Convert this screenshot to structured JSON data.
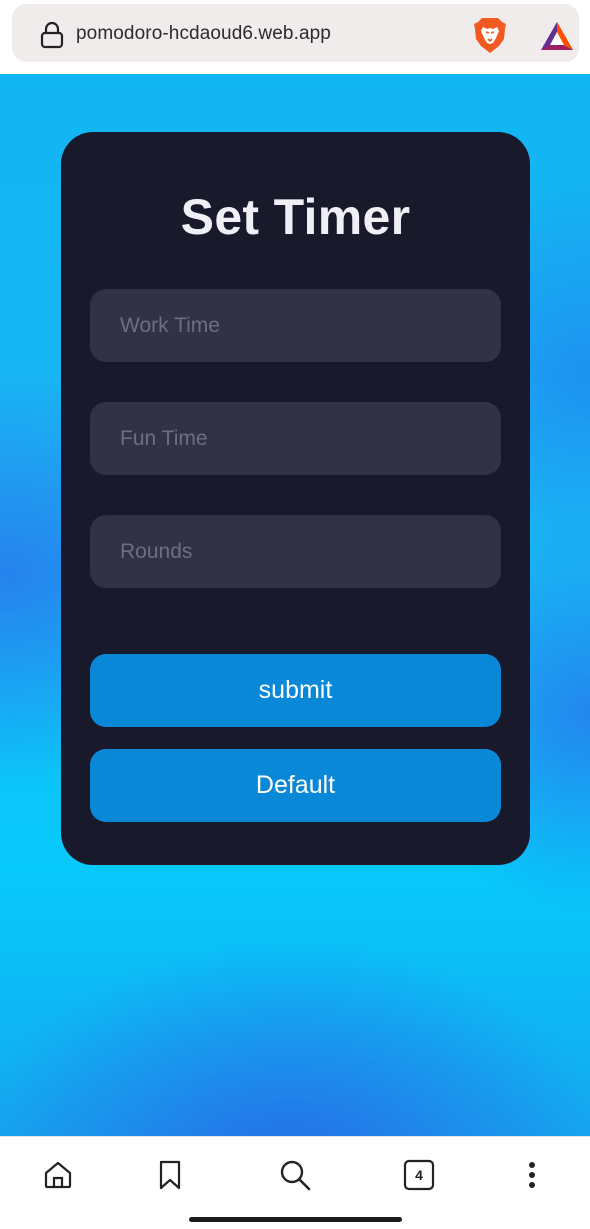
{
  "browser": {
    "url": "pomodoro-hcdaoud6.web.app",
    "icons": [
      "lock-icon",
      "brave-lion-icon",
      "bat-rewards-icon"
    ]
  },
  "form": {
    "title": "Set Timer",
    "fields": [
      {
        "placeholder": "Work Time",
        "value": ""
      },
      {
        "placeholder": "Fun Time",
        "value": ""
      },
      {
        "placeholder": "Rounds",
        "value": ""
      }
    ],
    "submit_label": "submit",
    "default_label": "Default"
  },
  "bottom_nav": {
    "items": [
      "home-icon",
      "bookmark-icon",
      "search-icon",
      "tabs-icon",
      "more-menu-icon"
    ],
    "tab_count": "4"
  },
  "colors": {
    "card_background": "#181a2c",
    "input_background": "#313246",
    "button_background": "#0a88d8",
    "page_gradient_primary": "#07c9fb",
    "page_gradient_secondary": "#2869e6"
  }
}
